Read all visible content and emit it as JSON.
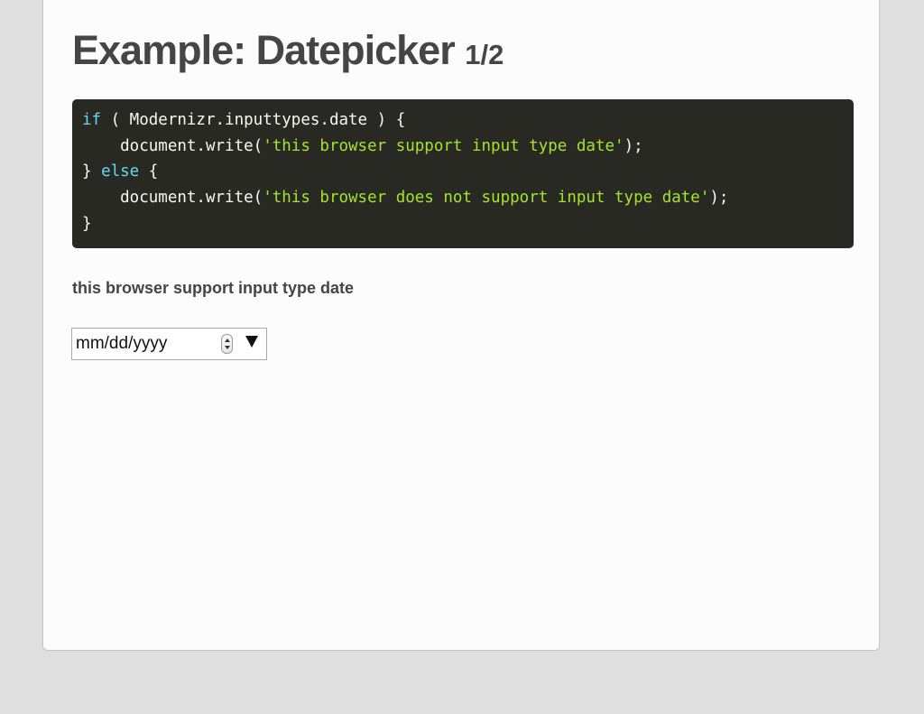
{
  "slide": {
    "title": "Example: Datepicker",
    "slide_counter": "1/2"
  },
  "code_block": {
    "lines": [
      [
        {
          "t": "if",
          "c": "kw"
        },
        {
          "t": " ( Modernizr.inputtypes.date ) {"
        }
      ],
      [
        {
          "t": "    document.write("
        },
        {
          "t": "'this browser support input type date'",
          "c": "str"
        },
        {
          "t": ");"
        }
      ],
      [
        {
          "t": "} "
        },
        {
          "t": "else",
          "c": "kw"
        },
        {
          "t": " {"
        }
      ],
      [
        {
          "t": "    document.write("
        },
        {
          "t": "'this browser does not support input type date'",
          "c": "str"
        },
        {
          "t": ");"
        }
      ],
      [
        {
          "t": "}"
        }
      ]
    ]
  },
  "output": {
    "result_text": "this browser support input type date"
  },
  "date_input": {
    "value": "mm/dd/yyyy",
    "spinner_icon": "up-down-spinner-icon",
    "dropdown_icon": "triangle-down-icon"
  },
  "colors": {
    "page_background": "#dfdfdf",
    "slide_background": "#fcfcfc",
    "title_text": "#454545",
    "code_background": "#282923",
    "code_text": "#f8f8f2",
    "code_keyword": "#66d9ef",
    "code_string": "#a6e22e"
  }
}
